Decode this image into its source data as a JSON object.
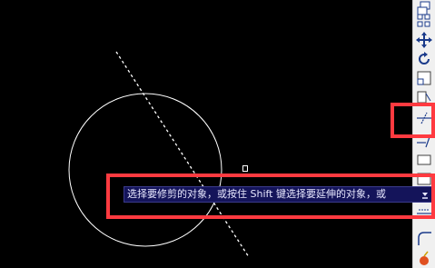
{
  "command_line": {
    "prompt_text": "选择要修剪的对象，或按住 Shift 键选择要延伸的对象，或"
  },
  "toolbar": {
    "tools": [
      {
        "name": "copy-icon"
      },
      {
        "name": "array-icon"
      },
      {
        "name": "move-icon"
      },
      {
        "name": "rotate-icon"
      },
      {
        "name": "scale-icon"
      },
      {
        "name": "stretch-icon"
      },
      {
        "name": "trim-icon"
      },
      {
        "name": "extend-icon"
      },
      {
        "name": "break-icon"
      },
      {
        "name": "join-icon"
      },
      {
        "name": "chamfer-icon"
      },
      {
        "name": "fillet-icon"
      },
      {
        "name": "explode-icon"
      }
    ]
  },
  "colors": {
    "background": "#000000",
    "geometry": "#ffffff",
    "command_bar": "#14145a",
    "highlight": "#ff3a40",
    "toolbar": "#f0f0f0"
  }
}
